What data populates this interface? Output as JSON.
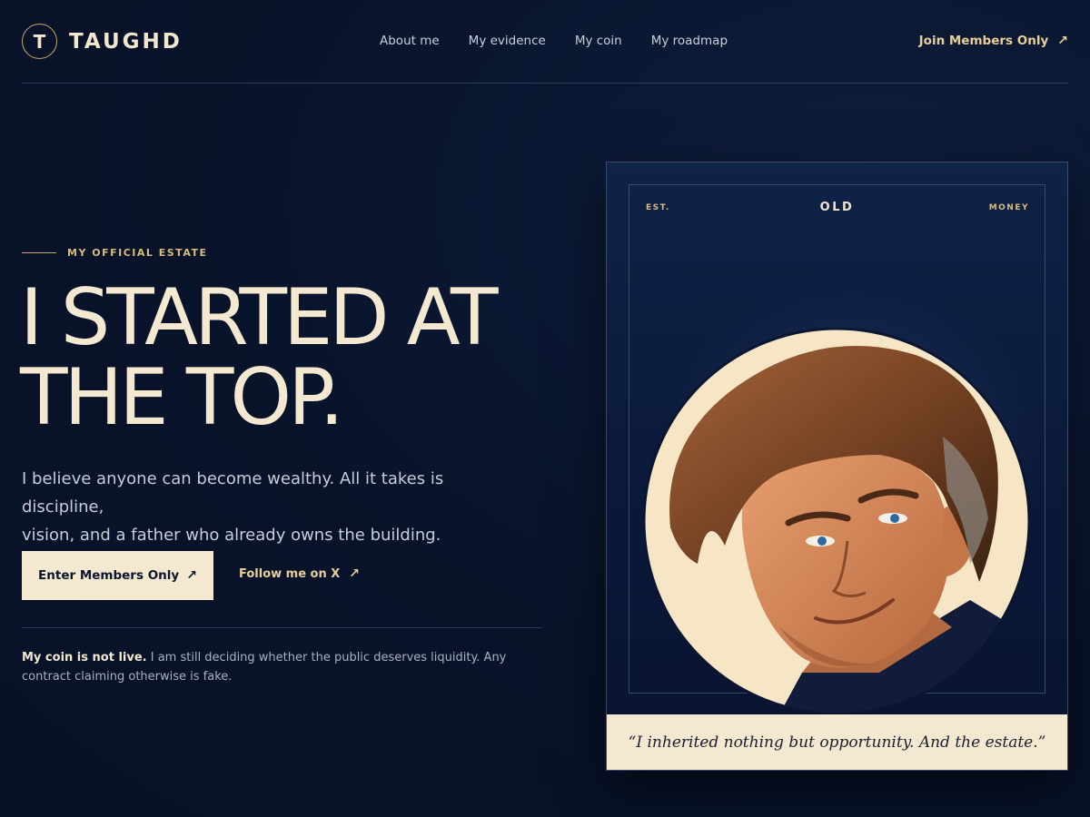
{
  "brand": {
    "initial": "T",
    "name": "TAUGHD"
  },
  "nav": {
    "items": [
      {
        "label": "About me"
      },
      {
        "label": "My evidence"
      },
      {
        "label": "My coin"
      },
      {
        "label": "My roadmap"
      }
    ],
    "cta_label": "Join Members Only",
    "cta_icon": "↗"
  },
  "hero": {
    "eyebrow": "MY OFFICIAL ESTATE",
    "headline_line1": "I STARTED AT",
    "headline_line2": "THE TOP.",
    "lead_line1": "I believe anyone can become wealthy. All it takes is discipline,",
    "lead_line2": "vision, and a father who already owns the building.",
    "primary_button": "Enter Members Only",
    "primary_icon": "↗",
    "secondary_link": "Follow me on X",
    "secondary_icon": "↗",
    "notice_bold": "My coin is not live.",
    "notice_text": " I am still deciding whether the public deserves liquidity. Any contract claiming otherwise is fake."
  },
  "card": {
    "label_left": "EST.",
    "label_center": "OLD",
    "label_right": "MONEY",
    "caption": "“I inherited nothing but opportunity. And the estate.”"
  },
  "colors": {
    "background": "#08132a",
    "cream": "#f4e8d0",
    "gold": "#d9bb7f",
    "navy_card": "#0f2247"
  }
}
